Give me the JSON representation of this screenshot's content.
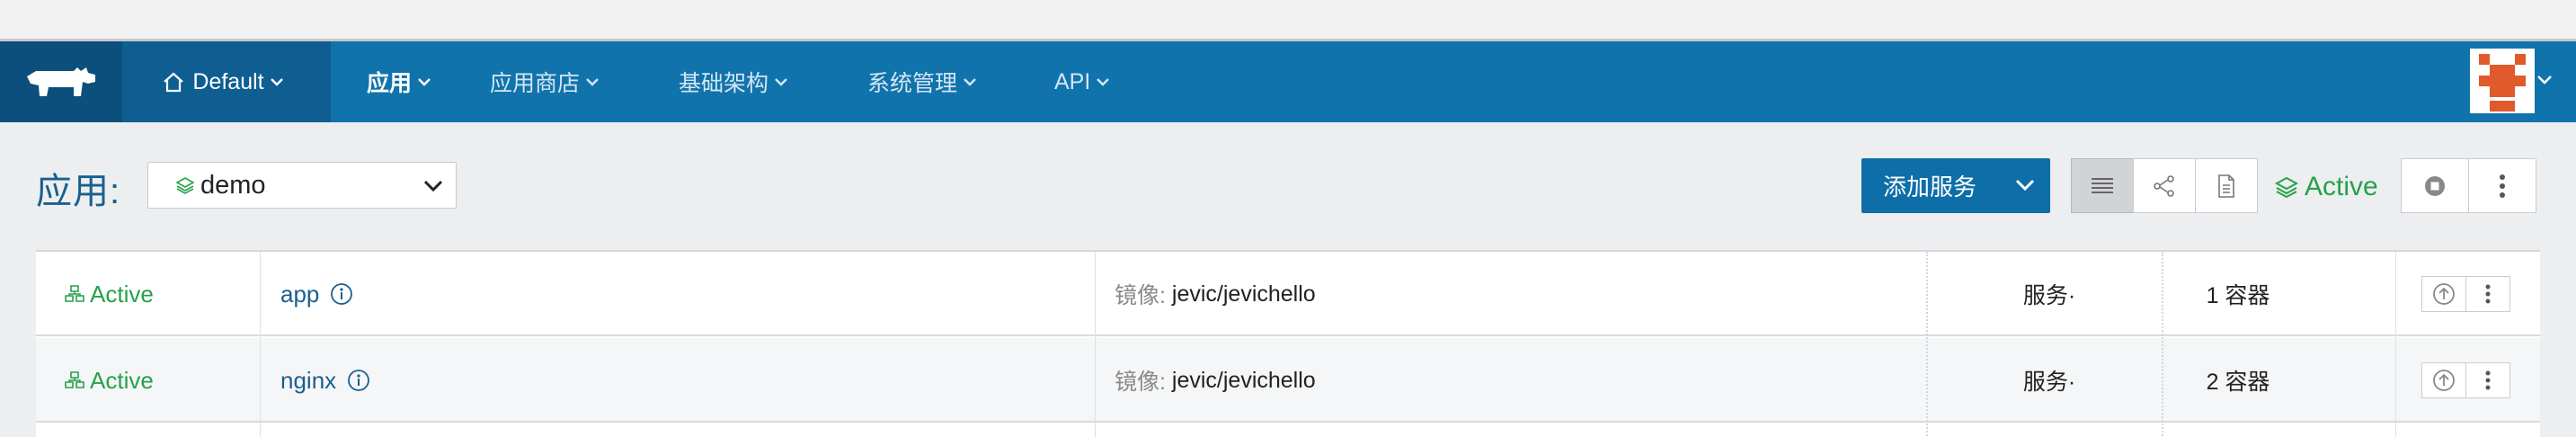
{
  "colors": {
    "nav_bg": "#1173ab",
    "nav_logo_bg": "#0c4f7c",
    "env_bg": "#0e5e92",
    "active_green": "#27a14a",
    "link_blue": "#1a5f8e",
    "primary_button": "#0e6ea8"
  },
  "nav": {
    "logo_icon": "ranch-cow-logo-icon",
    "environment": "Default",
    "items": [
      {
        "label": "应用",
        "selected": true
      },
      {
        "label": "应用商店",
        "selected": false
      },
      {
        "label": "基础架构",
        "selected": false
      },
      {
        "label": "系统管理",
        "selected": false
      },
      {
        "label": "API",
        "selected": false
      }
    ],
    "avatar_icon": "user-avatar-icon"
  },
  "stack": {
    "title": "应用:",
    "selected": "demo",
    "add_service_label": "添加服务",
    "state": "Active",
    "view_icons": [
      "list-view-icon",
      "graph-view-icon",
      "compose-file-icon"
    ],
    "action_icons": [
      "stop-icon",
      "more-icon"
    ]
  },
  "services": [
    {
      "state": "Active",
      "name": "app",
      "image_label": "镜像:",
      "image": "jevic/jevichello",
      "type": "服务·",
      "containers": "1 容器"
    },
    {
      "state": "Active",
      "name": "nginx",
      "image_label": "镜像:",
      "image": "jevic/jevichello",
      "type": "服务·",
      "containers": "2 容器"
    }
  ]
}
